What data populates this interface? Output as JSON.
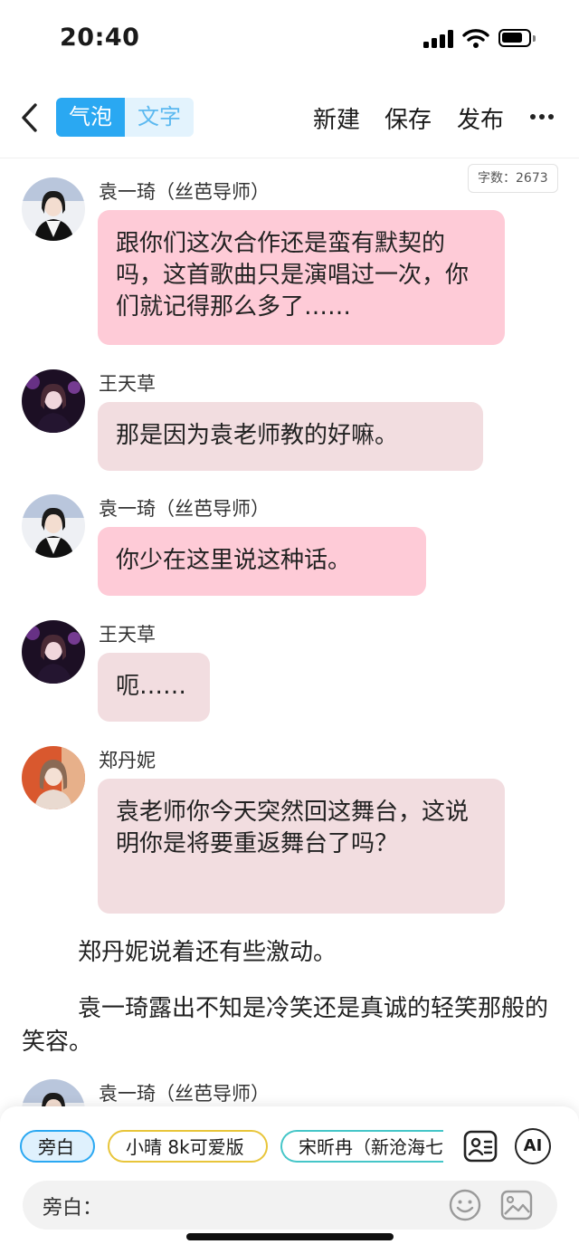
{
  "status_bar": {
    "time": "20:40"
  },
  "toolbar": {
    "tab_bubble": "气泡",
    "tab_text": "文字",
    "new_label": "新建",
    "save_label": "保存",
    "publish_label": "发布"
  },
  "word_count": "字数：2673",
  "messages": [
    {
      "sender": "袁一琦（丝芭导师）",
      "text": "跟你们这次合作还是蛮有默契的吗，这首歌曲只是演唱过一次，你们就记得那么多了……"
    },
    {
      "sender": "王天草",
      "text": "那是因为袁老师教的好嘛。"
    },
    {
      "sender": "袁一琦（丝芭导师）",
      "text": "你少在这里说这种话。"
    },
    {
      "sender": "王天草",
      "text": "呃……"
    },
    {
      "sender": "郑丹妮",
      "text": "袁老师你今天突然回这舞台，这说明你是将要重返舞台了吗？"
    }
  ],
  "narrations": [
    "郑丹妮说着还有些激动。",
    "袁一琦露出不知是冷笑还是真诚的轻笑那般的笑容。"
  ],
  "partial_message": {
    "sender": "袁一琦（丝芭导师）"
  },
  "bottom": {
    "chips": [
      "旁白",
      "小晴 8k可爱版",
      "宋昕冉（新沧海七"
    ],
    "ai_label": "AI",
    "input_label": "旁白："
  },
  "colors": {
    "accent": "#2aa8f2",
    "bubble_yuan": "#fecbd7",
    "bubble_other": "#f2dde0"
  }
}
